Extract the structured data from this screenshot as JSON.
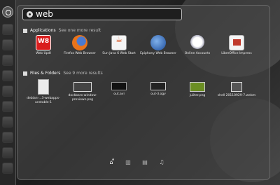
{
  "search": {
    "query": "web"
  },
  "applications": {
    "title": "Applications",
    "more": "See one more result",
    "items": [
      {
        "label": "Web UpdI",
        "icon": "w8-icon",
        "badge": "W8"
      },
      {
        "label": "Firefox Web Browser",
        "icon": "firefox-icon"
      },
      {
        "label": "Sun Java 6 Web Start",
        "icon": "java-icon"
      },
      {
        "label": "Epiphany Web Browser",
        "icon": "epiphany-icon"
      },
      {
        "label": "Online Accounts",
        "icon": "online-accounts-icon"
      },
      {
        "label": "LibreOffice Impress",
        "icon": "libreoffice-impress-icon"
      }
    ]
  },
  "files": {
    "title": "Files & Folders",
    "more": "See 9 more results",
    "items": [
      {
        "label": "debian-...3-webapps-unstable-1",
        "icon": "text-file-icon"
      },
      {
        "label": "dockbarx-window-previews.png",
        "icon": "image-file-icon"
      },
      {
        "label": "out.avi",
        "icon": "video-file-icon"
      },
      {
        "label": "out-3.ogv",
        "icon": "video-file-icon"
      },
      {
        "label": "juiiter.png",
        "icon": "image-file-icon"
      },
      {
        "label": "shell 20110929-7.webm",
        "icon": "video-file-icon"
      }
    ]
  },
  "lenses": [
    {
      "name": "home",
      "glyph": "⌂"
    },
    {
      "name": "apps",
      "glyph": "▥"
    },
    {
      "name": "files",
      "glyph": "▤"
    },
    {
      "name": "music",
      "glyph": "♫"
    }
  ]
}
